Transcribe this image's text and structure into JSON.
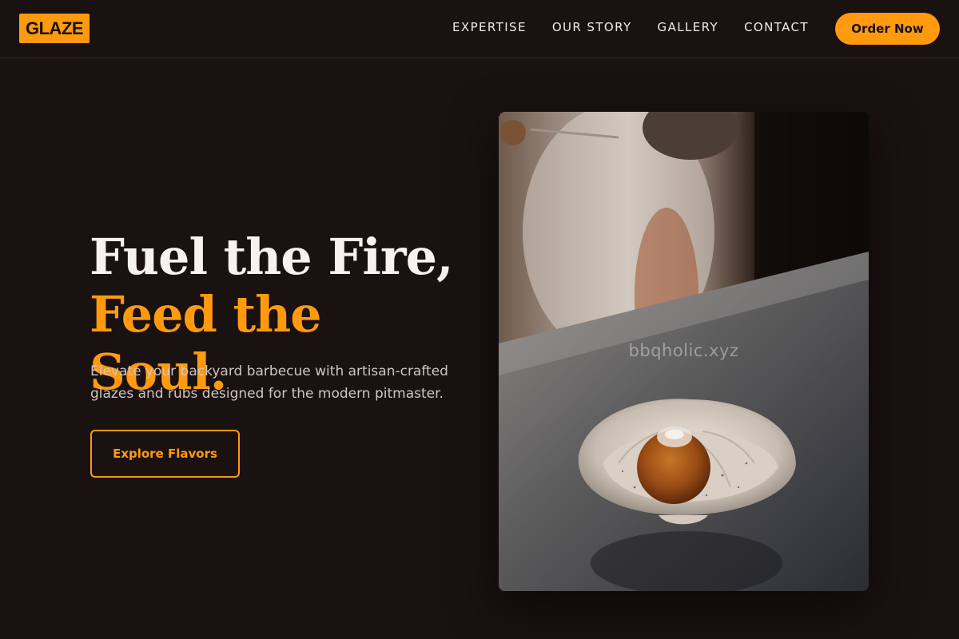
{
  "brand": {
    "logo_text": "GLAZE"
  },
  "nav": {
    "links": [
      "EXPERTISE",
      "OUR STORY",
      "GALLERY",
      "CONTACT"
    ],
    "cta_label": "Order Now"
  },
  "hero": {
    "title_line1": "Fuel the Fire,",
    "title_line2": "Feed the Soul.",
    "subtitle": "Elevate your backyard barbecue with artisan-crafted glazes and rubs designed for the modern pitmaster.",
    "cta_label": "Explore Flavors",
    "image": {
      "subject": "plated-dish-photo",
      "watermark": "bbqholic.xyz"
    }
  },
  "colors": {
    "background": "#1a1111",
    "accent": "#ff9a0f",
    "text": "#f7f2ee"
  }
}
